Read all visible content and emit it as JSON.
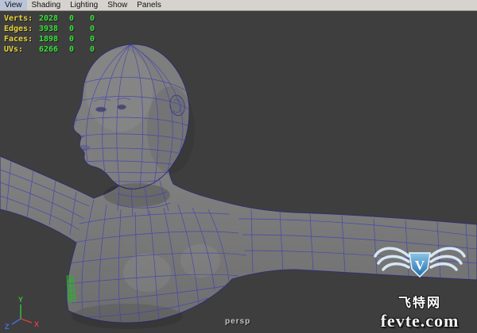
{
  "menu_bar": {
    "items": [
      "View",
      "Shading",
      "Lighting",
      "Show",
      "Panels"
    ]
  },
  "hud": {
    "rows": [
      {
        "label": "Verts:",
        "total": "2028",
        "selected": "0",
        "extra": "0"
      },
      {
        "label": "Edges:",
        "total": "3938",
        "selected": "0",
        "extra": "0"
      },
      {
        "label": "Faces:",
        "total": "1898",
        "selected": "0",
        "extra": "0"
      },
      {
        "label": "UVs:",
        "total": "6266",
        "selected": "0",
        "extra": "0"
      }
    ]
  },
  "viewport": {
    "camera_label": "persp",
    "background_color": "#3e3e3e",
    "model_color": "#7a7a7a",
    "wireframe_color": "#4242b4"
  },
  "axis": {
    "x_label": "X",
    "y_label": "Y",
    "z_label": "Z",
    "x_color": "#d84040",
    "y_color": "#38c038",
    "z_color": "#4a6ae8"
  },
  "watermark": {
    "logo": "winged-shield-v-icon",
    "site_name": "飞特网",
    "domain": "fevte.com"
  }
}
